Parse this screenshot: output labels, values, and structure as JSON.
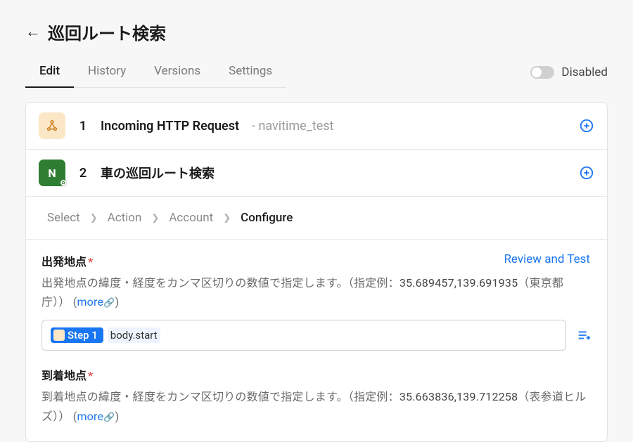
{
  "header": {
    "title": "巡回ルート検索"
  },
  "tabs": {
    "items": [
      "Edit",
      "History",
      "Versions",
      "Settings"
    ],
    "active_index": 0
  },
  "toggle": {
    "label": "Disabled"
  },
  "steps": [
    {
      "num": "1",
      "title": "Incoming HTTP Request",
      "subtitle": "- navitime_test",
      "icon": "webhook"
    },
    {
      "num": "2",
      "title": "車の巡回ルート検索",
      "subtitle": "",
      "icon": "navitime"
    }
  ],
  "breadcrumb": {
    "items": [
      "Select",
      "Action",
      "Account",
      "Configure"
    ],
    "active_index": 3
  },
  "review_link": "Review and Test",
  "fields": [
    {
      "label": "出発地点",
      "required": true,
      "help_prefix": "出発地点の緯度・経度をカンマ区切りの数値で指定します。（指定例：",
      "help_example": "35.689457,139.691935",
      "help_suffix": "（東京都庁）） (",
      "more": "more",
      "close": ")",
      "pill_label": "Step 1",
      "token_value": "body.start"
    },
    {
      "label": "到着地点",
      "required": true,
      "help_prefix": "到着地点の緯度・経度をカンマ区切りの数値で指定します。（指定例：",
      "help_example": "35.663836,139.712258",
      "help_suffix": "（表参道ヒルズ）） (",
      "more": "more",
      "close": ")"
    }
  ]
}
